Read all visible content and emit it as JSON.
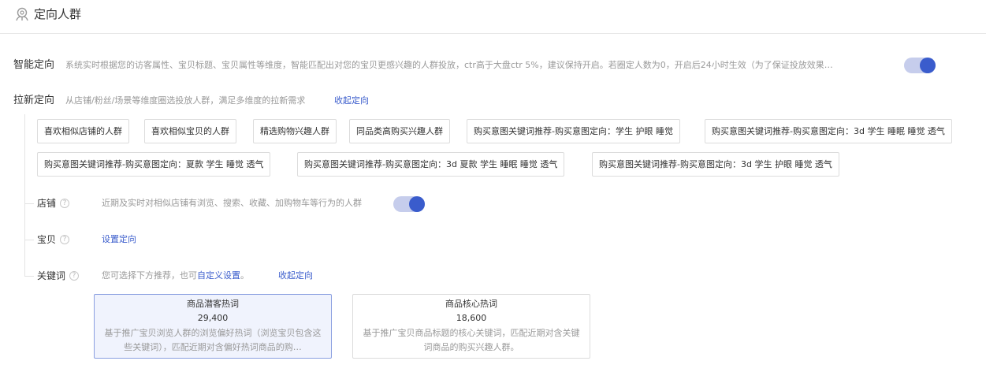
{
  "header": {
    "title": "定向人群",
    "icon": "crowd-icon"
  },
  "smart": {
    "label": "智能定向",
    "description": "系统实时根据您的访客属性、宝贝标题、宝贝属性等维度，智能匹配出对您的宝贝更感兴趣的人群投放，ctr高于大盘ctr 5%，建议保持开启。若圈定人数为0，开启后24小时生效（为了保证投放效果…",
    "enabled": true
  },
  "laxin": {
    "label": "拉新定向",
    "description": "从店铺/粉丝/场景等维度圈选投放人群，满足多维度的拉新需求",
    "collapse_link": "收起定向",
    "tags": [
      "喜欢相似店铺的人群",
      "喜欢相似宝贝的人群",
      "精选购物兴趣人群",
      "同品类高购买兴趣人群",
      "购买意图关键词推荐-购买意图定向：学生 护眼 睡觉",
      "购买意图关键词推荐-购买意图定向：3d 学生 睡眠 睡觉 透气",
      "购买意图关键词推荐-购买意图定向：夏款 学生 睡觉 透气",
      "购买意图关键词推荐-购买意图定向：3d 夏款 学生 睡眠 睡觉 透气",
      "购买意图关键词推荐-购买意图定向：3d 学生 护眼 睡觉 透气"
    ]
  },
  "shop": {
    "label": "店铺",
    "help": "?",
    "description": "近期及实时对相似店铺有浏览、搜索、收藏、加购物车等行为的人群",
    "enabled": true
  },
  "item": {
    "label": "宝贝",
    "help": "?",
    "link": "设置定向"
  },
  "keyword": {
    "label": "关键词",
    "help": "?",
    "desc_prefix": "您可选择下方推荐，也可",
    "custom_link": "自定义设置",
    "desc_suffix": "。",
    "collapse_link": "收起定向",
    "cards": [
      {
        "title": "商品潜客热词",
        "count": "29,400",
        "description": "基于推广宝贝浏览人群的浏览偏好热词（浏览宝贝包含这些关键词），匹配近期对含偏好热词商品的购…",
        "selected": true
      },
      {
        "title": "商品核心热词",
        "count": "18,600",
        "description": "基于推广宝贝商品标题的核心关键词，匹配近期对含关键词商品的购买兴趣人群。",
        "selected": false
      }
    ]
  },
  "colors": {
    "accent": "#3a5ccc",
    "toggle_track": "#c6cdec",
    "muted_text": "#999999",
    "card_selected_bg": "#f0f3fd"
  }
}
